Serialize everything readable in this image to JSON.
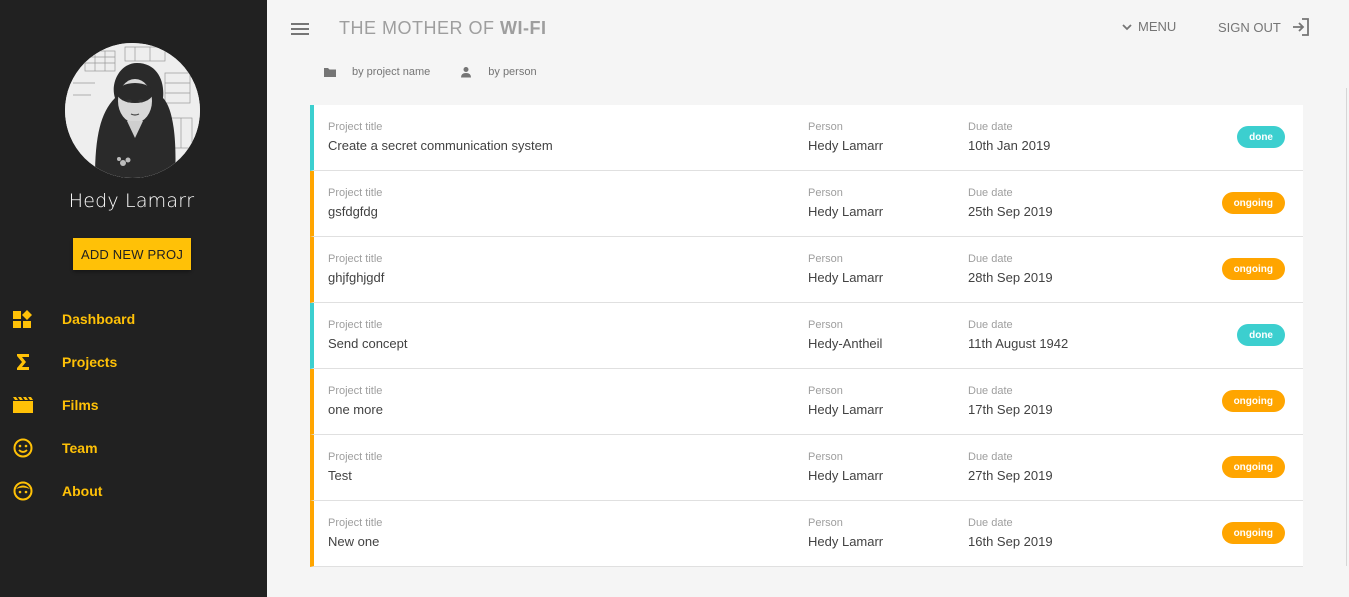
{
  "app": {
    "title_prefix": "THE MOTHER OF ",
    "title_bold": "WI-FI",
    "menu_label": "MENU",
    "signout_label": "SIGN OUT"
  },
  "user": {
    "name": "Hedy Lamarr"
  },
  "sidebar": {
    "add_button_label": "ADD NEW PROJ",
    "items": [
      {
        "label": "Dashboard",
        "icon": "dashboard-icon"
      },
      {
        "label": "Projects",
        "icon": "sigma-icon"
      },
      {
        "label": "Films",
        "icon": "film-icon"
      },
      {
        "label": "Team",
        "icon": "smiley-icon"
      },
      {
        "label": "About",
        "icon": "face-icon"
      }
    ]
  },
  "sort": {
    "by_project": "by project name",
    "by_person": "by person"
  },
  "labels": {
    "project_title": "Project title",
    "person": "Person",
    "due_date": "Due date"
  },
  "projects": [
    {
      "title": "Create a secret communication system",
      "person": "Hedy Lamarr",
      "due": "10th Jan 2019",
      "status": "done"
    },
    {
      "title": "gsfdgfdg",
      "person": "Hedy Lamarr",
      "due": "25th Sep 2019",
      "status": "ongoing"
    },
    {
      "title": "ghjfghjgdf",
      "person": "Hedy Lamarr",
      "due": "28th Sep 2019",
      "status": "ongoing"
    },
    {
      "title": "Send concept",
      "person": "Hedy-Antheil",
      "due": "11th August 1942",
      "status": "done"
    },
    {
      "title": "one more",
      "person": "Hedy Lamarr",
      "due": "17th Sep 2019",
      "status": "ongoing"
    },
    {
      "title": "Test",
      "person": "Hedy Lamarr",
      "due": "27th Sep 2019",
      "status": "ongoing"
    },
    {
      "title": "New one",
      "person": "Hedy Lamarr",
      "due": "16th Sep 2019",
      "status": "ongoing"
    }
  ],
  "colors": {
    "sidebar_bg": "#212121",
    "accent": "#ffc107",
    "done": "#3ccfcf",
    "ongoing": "#ffa500"
  }
}
